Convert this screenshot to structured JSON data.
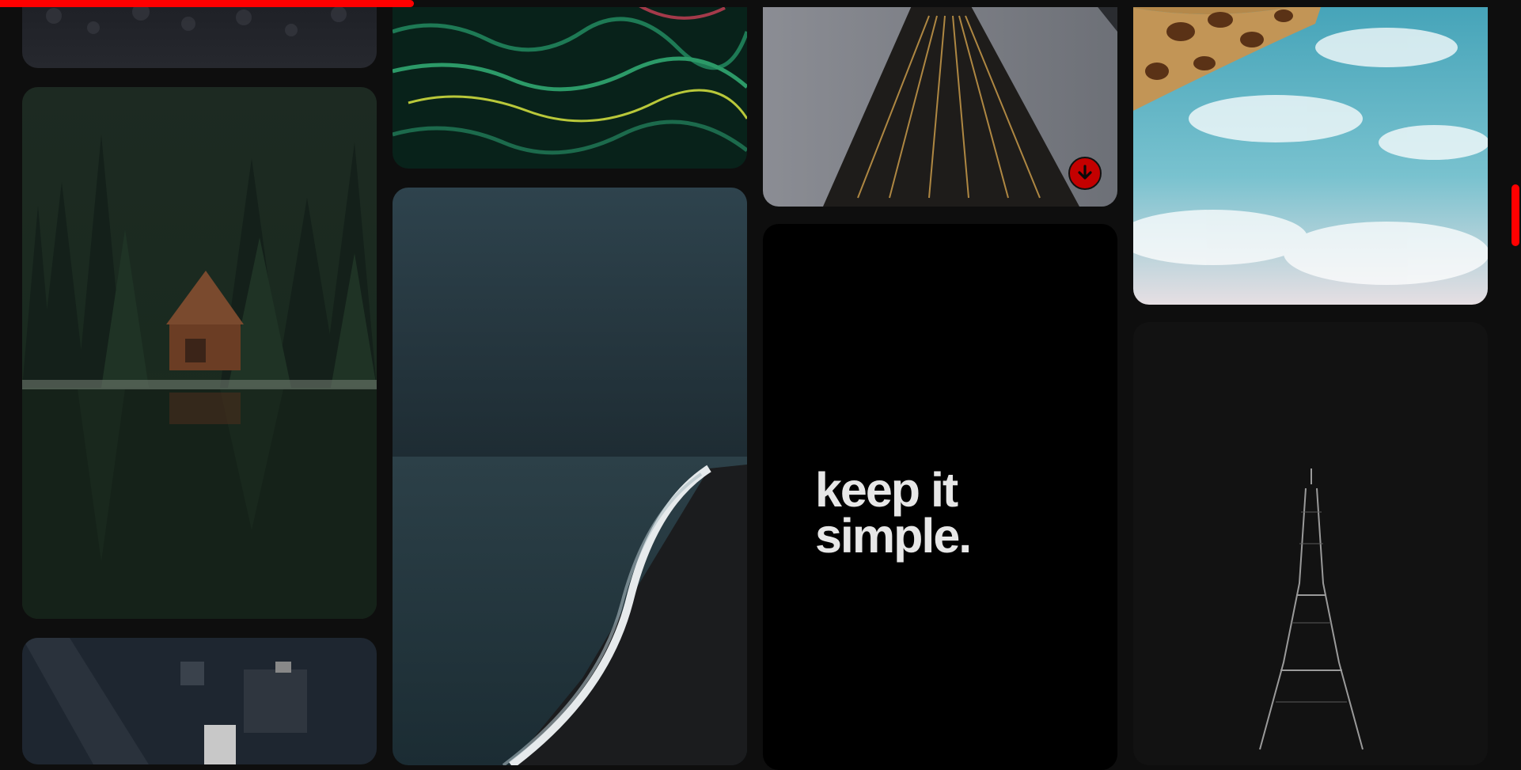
{
  "gallery": {
    "poster_text_line1": "keep it",
    "poster_text_line2": "simple.",
    "download_icon": "arrow-down-circle-icon",
    "accent_color": "#ff0000"
  }
}
